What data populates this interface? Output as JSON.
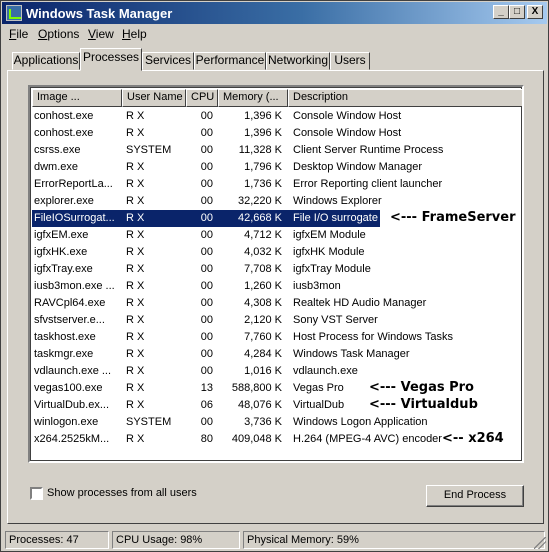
{
  "window": {
    "title": "Windows Task Manager"
  },
  "title_controls": {
    "minimize": "_",
    "maximize": "□",
    "close": "X"
  },
  "menu": [
    {
      "label": "File",
      "u": "F",
      "rest": "ile"
    },
    {
      "label": "Options",
      "u": "O",
      "rest": "ptions"
    },
    {
      "label": "View",
      "u": "V",
      "rest": "iew"
    },
    {
      "label": "Help",
      "u": "H",
      "rest": "elp"
    }
  ],
  "tabs": [
    "Applications",
    "Processes",
    "Services",
    "Performance",
    "Networking",
    "Users"
  ],
  "active_tab": "Processes",
  "columns": [
    "Image ...",
    "User Name",
    "CPU",
    "Memory (...",
    "Description"
  ],
  "rows": [
    {
      "name": "conhost.exe",
      "user": "R X",
      "cpu": "00",
      "mem": "1,396 K",
      "desc": "Console Window Host"
    },
    {
      "name": "conhost.exe",
      "user": "R X",
      "cpu": "00",
      "mem": "1,396 K",
      "desc": "Console Window Host"
    },
    {
      "name": "csrss.exe",
      "user": "SYSTEM",
      "cpu": "00",
      "mem": "11,328 K",
      "desc": "Client Server Runtime Process"
    },
    {
      "name": "dwm.exe",
      "user": "R X",
      "cpu": "00",
      "mem": "1,796 K",
      "desc": "Desktop Window Manager"
    },
    {
      "name": "ErrorReportLa...",
      "user": "R X",
      "cpu": "00",
      "mem": "1,736 K",
      "desc": "Error Reporting client launcher"
    },
    {
      "name": "explorer.exe",
      "user": "R X",
      "cpu": "00",
      "mem": "32,220 K",
      "desc": "Windows Explorer"
    },
    {
      "name": "FileIOSurrogat...",
      "user": "R X",
      "cpu": "00",
      "mem": "42,668 K",
      "desc": "File I/O surrogate",
      "selected": true
    },
    {
      "name": "igfxEM.exe",
      "user": "R X",
      "cpu": "00",
      "mem": "4,712 K",
      "desc": "igfxEM Module"
    },
    {
      "name": "igfxHK.exe",
      "user": "R X",
      "cpu": "00",
      "mem": "4,032 K",
      "desc": "igfxHK Module"
    },
    {
      "name": "igfxTray.exe",
      "user": "R X",
      "cpu": "00",
      "mem": "7,708 K",
      "desc": "igfxTray Module"
    },
    {
      "name": "iusb3mon.exe ...",
      "user": "R X",
      "cpu": "00",
      "mem": "1,260 K",
      "desc": "iusb3mon"
    },
    {
      "name": "RAVCpl64.exe",
      "user": "R X",
      "cpu": "00",
      "mem": "4,308 K",
      "desc": "Realtek HD Audio Manager"
    },
    {
      "name": "sfvstserver.e...",
      "user": "R X",
      "cpu": "00",
      "mem": "2,120 K",
      "desc": "Sony VST Server"
    },
    {
      "name": "taskhost.exe",
      "user": "R X",
      "cpu": "00",
      "mem": "7,760 K",
      "desc": "Host Process for Windows Tasks"
    },
    {
      "name": "taskmgr.exe",
      "user": "R X",
      "cpu": "00",
      "mem": "4,284 K",
      "desc": "Windows Task Manager"
    },
    {
      "name": "vdlaunch.exe ...",
      "user": "R X",
      "cpu": "00",
      "mem": "1,016 K",
      "desc": "vdlaunch.exe"
    },
    {
      "name": "vegas100.exe",
      "user": "R X",
      "cpu": "13",
      "mem": "588,800 K",
      "desc": "Vegas Pro"
    },
    {
      "name": "VirtualDub.ex...",
      "user": "R X",
      "cpu": "06",
      "mem": "48,076 K",
      "desc": "VirtualDub"
    },
    {
      "name": "winlogon.exe",
      "user": "SYSTEM",
      "cpu": "00",
      "mem": "3,736 K",
      "desc": "Windows Logon Application"
    },
    {
      "name": "x264.2525kM...",
      "user": "R X",
      "cpu": "80",
      "mem": "409,048 K",
      "desc": "H.264 (MPEG-4 AVC) encoder"
    }
  ],
  "annotations": {
    "frameserver": "<--- FrameServer",
    "vegas": "<--- Vegas Pro",
    "virtualdub": "<--- Virtualdub",
    "x264": "<-- x264"
  },
  "show_all_label": "Show processes from all users",
  "show_all_checked": false,
  "end_process_label": "End Process",
  "status": {
    "processes": "Processes: 47",
    "cpu": "CPU Usage: 98%",
    "memory": "Physical Memory: 59%"
  }
}
